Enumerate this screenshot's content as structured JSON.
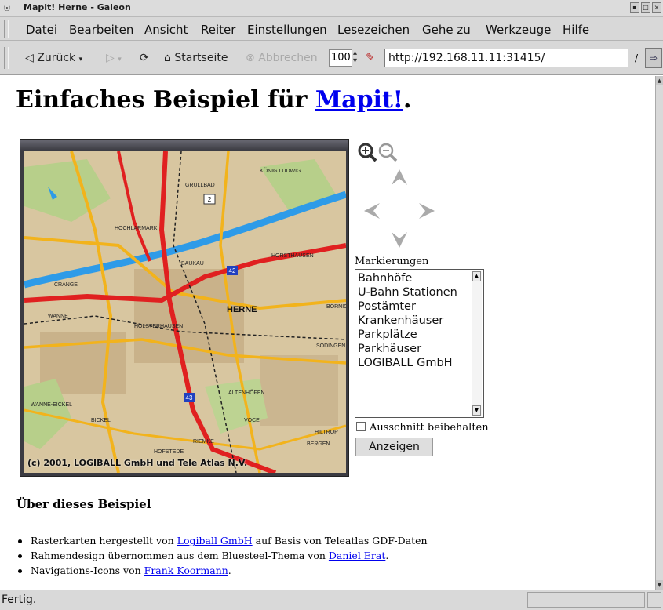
{
  "window": {
    "title": "Mapit! Herne - Galeon",
    "close_glyph": "×",
    "maximize_glyph": "□",
    "minimize_glyph": "▪"
  },
  "menu": {
    "items": [
      "Datei",
      "Bearbeiten",
      "Ansicht",
      "Reiter",
      "Einstellungen",
      "Lesezeichen",
      "Gehe zu",
      "Werkzeuge",
      "Hilfe"
    ]
  },
  "toolbar": {
    "back_label": "Zurück",
    "home_label": "Startseite",
    "stop_label": "Abbrechen",
    "zoom_value": "100",
    "url": "http://192.168.11.11:31415/"
  },
  "page": {
    "heading_prefix": "Einfaches Beispiel für ",
    "heading_link": "Mapit!",
    "heading_suffix": "."
  },
  "map": {
    "copyright": "(c) 2001, LOGIBALL GmbH und Tele Atlas N.V.",
    "city_label": "HERNE",
    "district_labels": [
      "KÖNIG LUDWIG",
      "CRANGE",
      "BAUKAU",
      "HORSTHAUSEN",
      "HOLSTERHAUSEN",
      "WANNE",
      "BICKEL",
      "ALTENHÖFEN",
      "VOCE",
      "HOFSTEDE",
      "RIEMKE",
      "SODINGEN",
      "BÖRNIG",
      "GRULLBAD",
      "HOCHLARMARK",
      "BERGEN",
      "WANNE-EICKEL",
      "HILTROP"
    ],
    "road_signs": [
      "2",
      "42",
      "43"
    ]
  },
  "controls": {
    "markers_label": "Markierungen",
    "markers": [
      "Bahnhöfe",
      "U-Bahn Stationen",
      "Postämter",
      "Krankenhäuser",
      "Parkplätze",
      "Parkhäuser",
      "LOGIBALL GmbH"
    ],
    "keep_view_label": "Ausschnitt beibehalten",
    "show_button": "Anzeigen"
  },
  "about": {
    "heading": "Über dieses Beispiel",
    "item1_text_a": "Rasterkarten hergestellt von ",
    "item1_link": "Logiball GmbH",
    "item1_text_b": " auf Basis von Teleatlas GDF-Daten",
    "item2_text_a": "Rahmendesign übernommen aus dem Bluesteel-Thema von ",
    "item2_link": "Daniel Erat",
    "item2_text_b": ".",
    "item3_text_a": "Navigations-Icons von ",
    "item3_link": "Frank Koormann",
    "item3_text_b": "."
  },
  "status": {
    "text": "Fertig."
  },
  "colors": {
    "link": "#0000ee",
    "river": "#2e9be8",
    "motorway": "#e02020",
    "main_road": "#f2b31c",
    "map_base": "#d8c6a0"
  }
}
